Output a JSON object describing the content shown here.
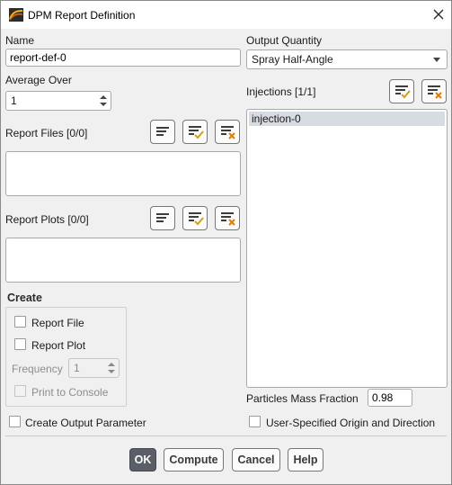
{
  "window": {
    "title": "DPM Report Definition",
    "icon": "fluent-app-icon",
    "close_icon": "close-icon"
  },
  "name": {
    "label": "Name",
    "value": "report-def-0"
  },
  "average_over": {
    "label": "Average Over",
    "value": "1"
  },
  "report_files": {
    "label": "Report Files",
    "count": "[0/0]",
    "icons": [
      "list-icon",
      "list-select-all-icon",
      "list-deselect-all-icon"
    ]
  },
  "report_plots": {
    "label": "Report Plots",
    "count": "[0/0]",
    "icons": [
      "list-icon",
      "list-select-all-icon",
      "list-deselect-all-icon"
    ]
  },
  "create": {
    "title": "Create",
    "report_file_label": "Report File",
    "report_file_checked": false,
    "report_plot_label": "Report Plot",
    "report_plot_checked": false,
    "frequency_label": "Frequency",
    "frequency_value": "1",
    "print_to_console_label": "Print to Console",
    "print_to_console_checked": false
  },
  "create_output_parameter": {
    "label": "Create Output Parameter",
    "checked": false
  },
  "output_quantity": {
    "label": "Output Quantity",
    "selected": "Spray Half-Angle"
  },
  "injections": {
    "label": "Injections",
    "count": "[1/1]",
    "items": [
      "injection-0"
    ],
    "icons": [
      "list-select-all-icon",
      "list-deselect-all-icon"
    ]
  },
  "particles_mass_fraction": {
    "label": "Particles Mass Fraction",
    "value": "0.98"
  },
  "user_specified_origin": {
    "label": "User-Specified Origin and Direction",
    "checked": false
  },
  "buttons": {
    "ok": "OK",
    "compute": "Compute",
    "cancel": "Cancel",
    "help": "Help"
  },
  "colors": {
    "primary_button": "#5a5e66",
    "selection": "#d7dbe2",
    "check_accent": "#d4a017",
    "deselect_accent": "#e07b00"
  }
}
